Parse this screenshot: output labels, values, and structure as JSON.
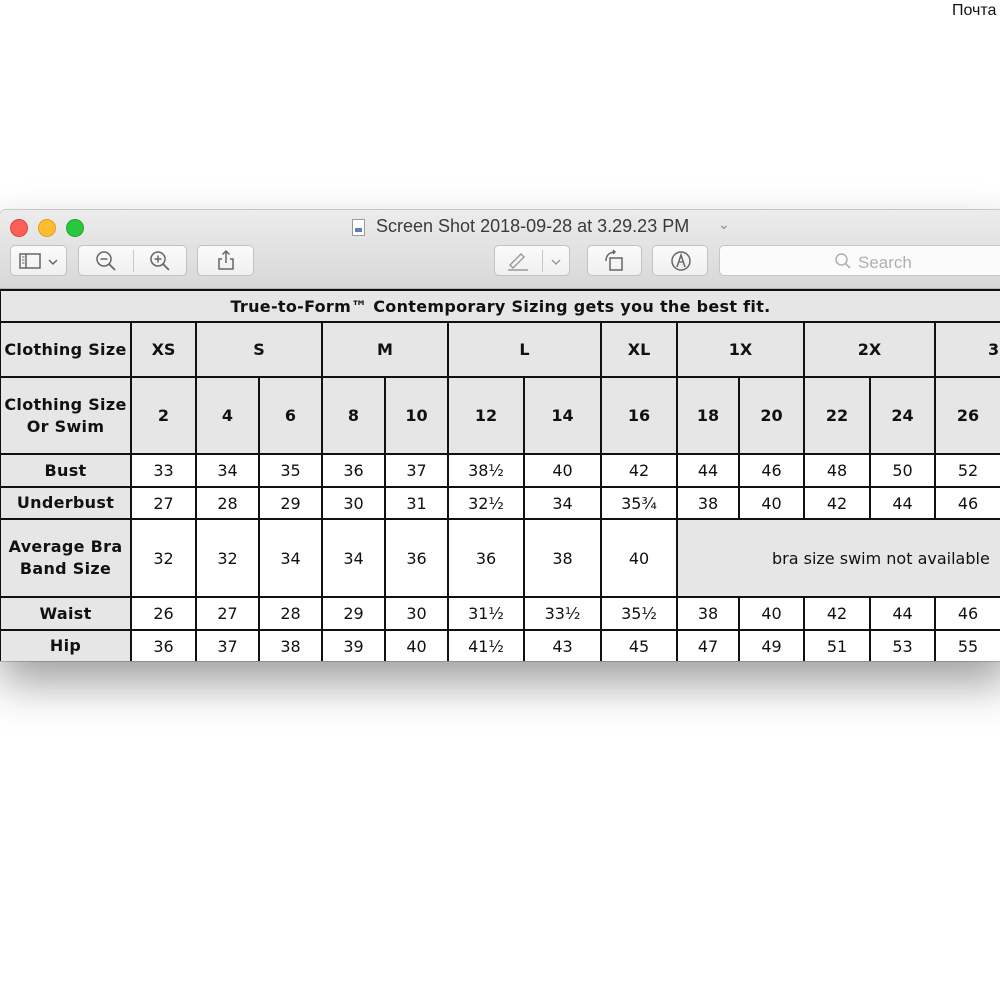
{
  "corner_text": "Почта",
  "window": {
    "title": "Screen Shot 2018-09-28 at 3.29.23 PM",
    "search_placeholder": "Search",
    "icons": [
      "sidebar-icon",
      "chevron-down-icon",
      "zoom-out-icon",
      "zoom-in-icon",
      "share-icon",
      "markup-pen-icon",
      "rotate-icon",
      "annotate-icon",
      "search-icon"
    ]
  },
  "chart": {
    "banner": "True-to-Form™ Contemporary Sizing gets you the best fit.",
    "row_labels": {
      "clothing_size": "Clothing Size",
      "clothing_size_or_swim": "Clothing Size Or Swim",
      "bust": "Bust",
      "underbust": "Underbust",
      "average_bra_band_size": "Average Bra Band Size",
      "waist": "Waist",
      "hip": "Hip"
    },
    "letter_sizes": [
      "XS",
      "S",
      "M",
      "L",
      "XL",
      "1X",
      "2X",
      "3"
    ],
    "numeric_sizes": [
      "2",
      "4",
      "6",
      "8",
      "10",
      "12",
      "14",
      "16",
      "18",
      "20",
      "22",
      "24",
      "26"
    ],
    "bust": [
      "33",
      "34",
      "35",
      "36",
      "37",
      "38½",
      "40",
      "42",
      "44",
      "46",
      "48",
      "50",
      "52"
    ],
    "underbust": [
      "27",
      "28",
      "29",
      "30",
      "31",
      "32½",
      "34",
      "35¾",
      "38",
      "40",
      "42",
      "44",
      "46"
    ],
    "average_bra_band_size": [
      "32",
      "32",
      "34",
      "34",
      "36",
      "36",
      "38",
      "40"
    ],
    "bra_not_available": "bra size swim not available",
    "waist": [
      "26",
      "27",
      "28",
      "29",
      "30",
      "31½",
      "33½",
      "35½",
      "38",
      "40",
      "42",
      "44",
      "46"
    ],
    "hip": [
      "36",
      "37",
      "38",
      "39",
      "40",
      "41½",
      "43",
      "45",
      "47",
      "49",
      "51",
      "53",
      "55"
    ]
  }
}
